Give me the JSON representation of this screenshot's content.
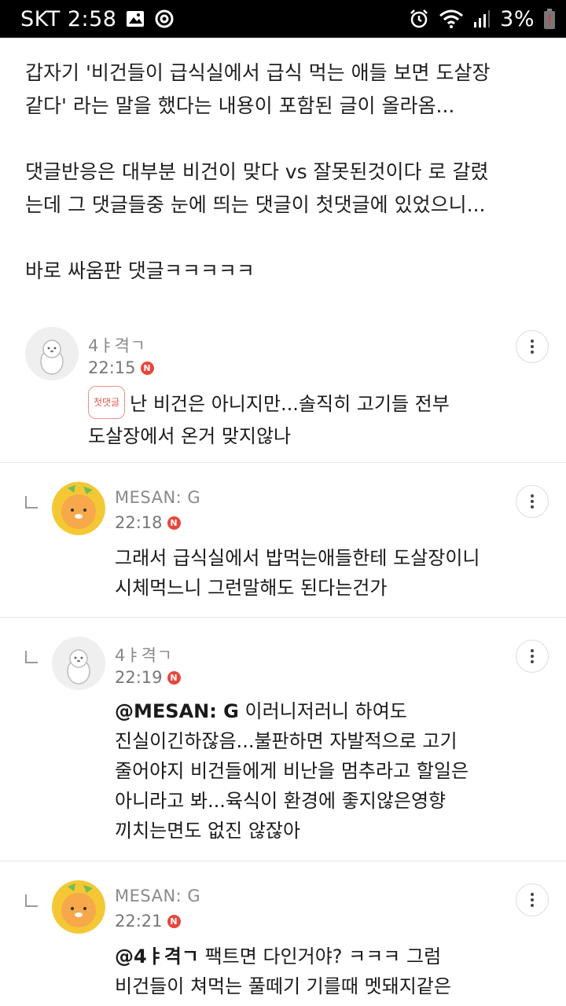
{
  "status_bar": {
    "carrier_time": "SKT 2:58",
    "battery": "3%",
    "icons": [
      "gallery-icon",
      "sync-icon",
      "alarm-icon",
      "wifi-icon",
      "signal-icon",
      "battery-icon"
    ]
  },
  "post": {
    "lines": [
      "갑자기 '비건들이 급식실에서 급식 먹는 애들 보면 도살장",
      "같다' 라는 말을 했다는 내용이 포함된 글이 올라옴...",
      "댓글반응은 대부분 비건이 맞다 vs 잘못된것이다 로 갈렸",
      "는데 그 댓글들중 눈에 띄는 댓글이 첫댓글에 있었으니...",
      "바로 싸움판 댓글ㅋㅋㅋㅋㅋ"
    ]
  },
  "comments": [
    {
      "author": "4ㅑ격ㄱ",
      "time": "22:15",
      "badge": "첫댓글",
      "new": "N",
      "lines": [
        "난 비건은 아니지만...솔직히 고기들 전부",
        "도살장에서 온거 맞지않나"
      ]
    },
    {
      "author": "MESAN: G",
      "time": "22:18",
      "new": "N",
      "lines": [
        "그래서 급식실에서 밥먹는애들한테 도살장이니",
        "시체먹느니 그런말해도 된다는건가"
      ]
    },
    {
      "author": "4ㅑ격ㄱ",
      "time": "22:19",
      "new": "N",
      "mention": "@MESAN: G",
      "lines": [
        " 이러니저러니 하여도",
        "진실이긴하잖음...불판하면 자발적으로 고기",
        "줄어야지 비건들에게 비난을 멈추라고 할일은",
        "아니라고 봐...육식이 환경에 좋지않은영향",
        "끼치는면도 없진 않잖아"
      ]
    },
    {
      "author": "MESAN: G",
      "time": "22:21",
      "new": "N",
      "mention": "@4ㅑ격ㄱ",
      "lines": [
        " 팩트면 다인거야? ㅋㅋㅋ 그럼",
        "비건들이 쳐먹는 풀떼기 기를때 멧돼지같은"
      ]
    }
  ],
  "colors": {
    "new_badge": "#e8463b",
    "first_badge": "#e35b50",
    "avatar_yellow": "#f3c834"
  }
}
